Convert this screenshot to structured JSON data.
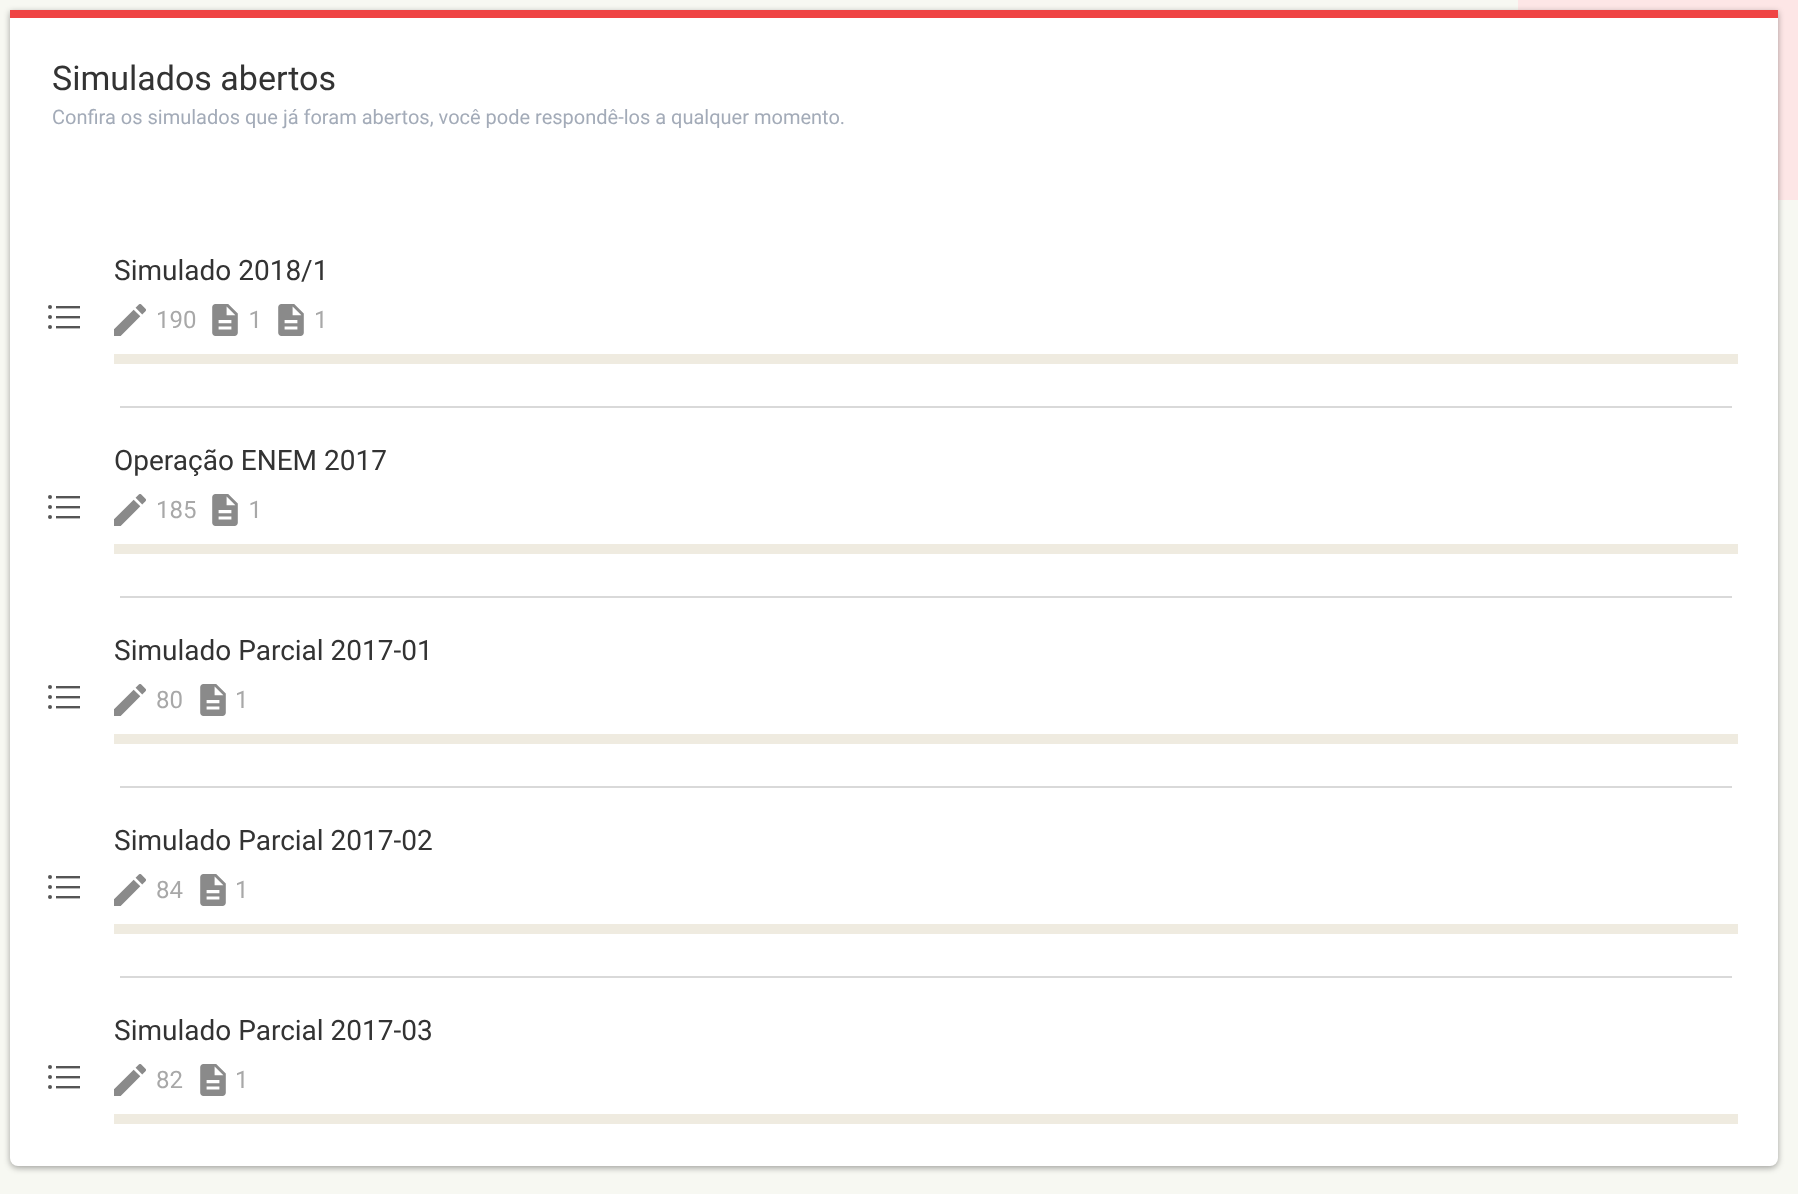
{
  "header": {
    "title": "Simulados abertos",
    "subtitle": "Confira os simulados que já foram abertos, você pode respondê-los a qualquer momento."
  },
  "exams": [
    {
      "title": "Simulado 2018/1",
      "stats": [
        {
          "kind": "questions",
          "value": "190"
        },
        {
          "kind": "document",
          "value": "1"
        },
        {
          "kind": "document",
          "value": "1"
        }
      ]
    },
    {
      "title": "Operação ENEM 2017",
      "stats": [
        {
          "kind": "questions",
          "value": "185"
        },
        {
          "kind": "document",
          "value": "1"
        }
      ]
    },
    {
      "title": "Simulado Parcial 2017-01",
      "stats": [
        {
          "kind": "questions",
          "value": "80"
        },
        {
          "kind": "document",
          "value": "1"
        }
      ]
    },
    {
      "title": "Simulado Parcial 2017-02",
      "stats": [
        {
          "kind": "questions",
          "value": "84"
        },
        {
          "kind": "document",
          "value": "1"
        }
      ]
    },
    {
      "title": "Simulado Parcial 2017-03",
      "stats": [
        {
          "kind": "questions",
          "value": "82"
        },
        {
          "kind": "document",
          "value": "1"
        }
      ]
    }
  ]
}
